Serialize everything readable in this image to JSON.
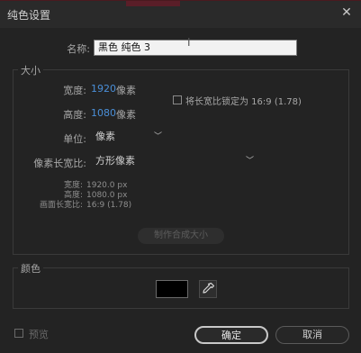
{
  "window": {
    "title": "纯色设置",
    "close_glyph": "✕"
  },
  "name_row": {
    "label": "名称:",
    "value": "黑色 纯色 3",
    "cursor_glyph": "I"
  },
  "size_group": {
    "title": "大小",
    "width_label": "宽度:",
    "width_value": "1920",
    "width_unit": "像素",
    "height_label": "高度:",
    "height_value": "1080",
    "height_unit": "像素",
    "lock_aspect_label": "将长宽比锁定为 16:9 (1.78)",
    "lock_aspect_checked": false,
    "units_label": "单位:",
    "units_value": "像素",
    "pixel_aspect_label": "像素长宽比:",
    "pixel_aspect_value": "方形像素",
    "info": {
      "width_label": "宽度:",
      "width_value": "1920.0 px",
      "height_label": "高度:",
      "height_value": "1080.0 px",
      "frame_aspect_label": "画面长宽比:",
      "frame_aspect_value": "16:9 (1.78)"
    },
    "make_comp_size_label": "制作合成大小"
  },
  "color_group": {
    "title": "颜色",
    "swatch_color": "#000000"
  },
  "footer": {
    "preview_label": "预览",
    "ok_label": "确定",
    "cancel_label": "取消"
  },
  "colors": {
    "accent_blue": "#4a8fd8",
    "background": "#232323"
  }
}
